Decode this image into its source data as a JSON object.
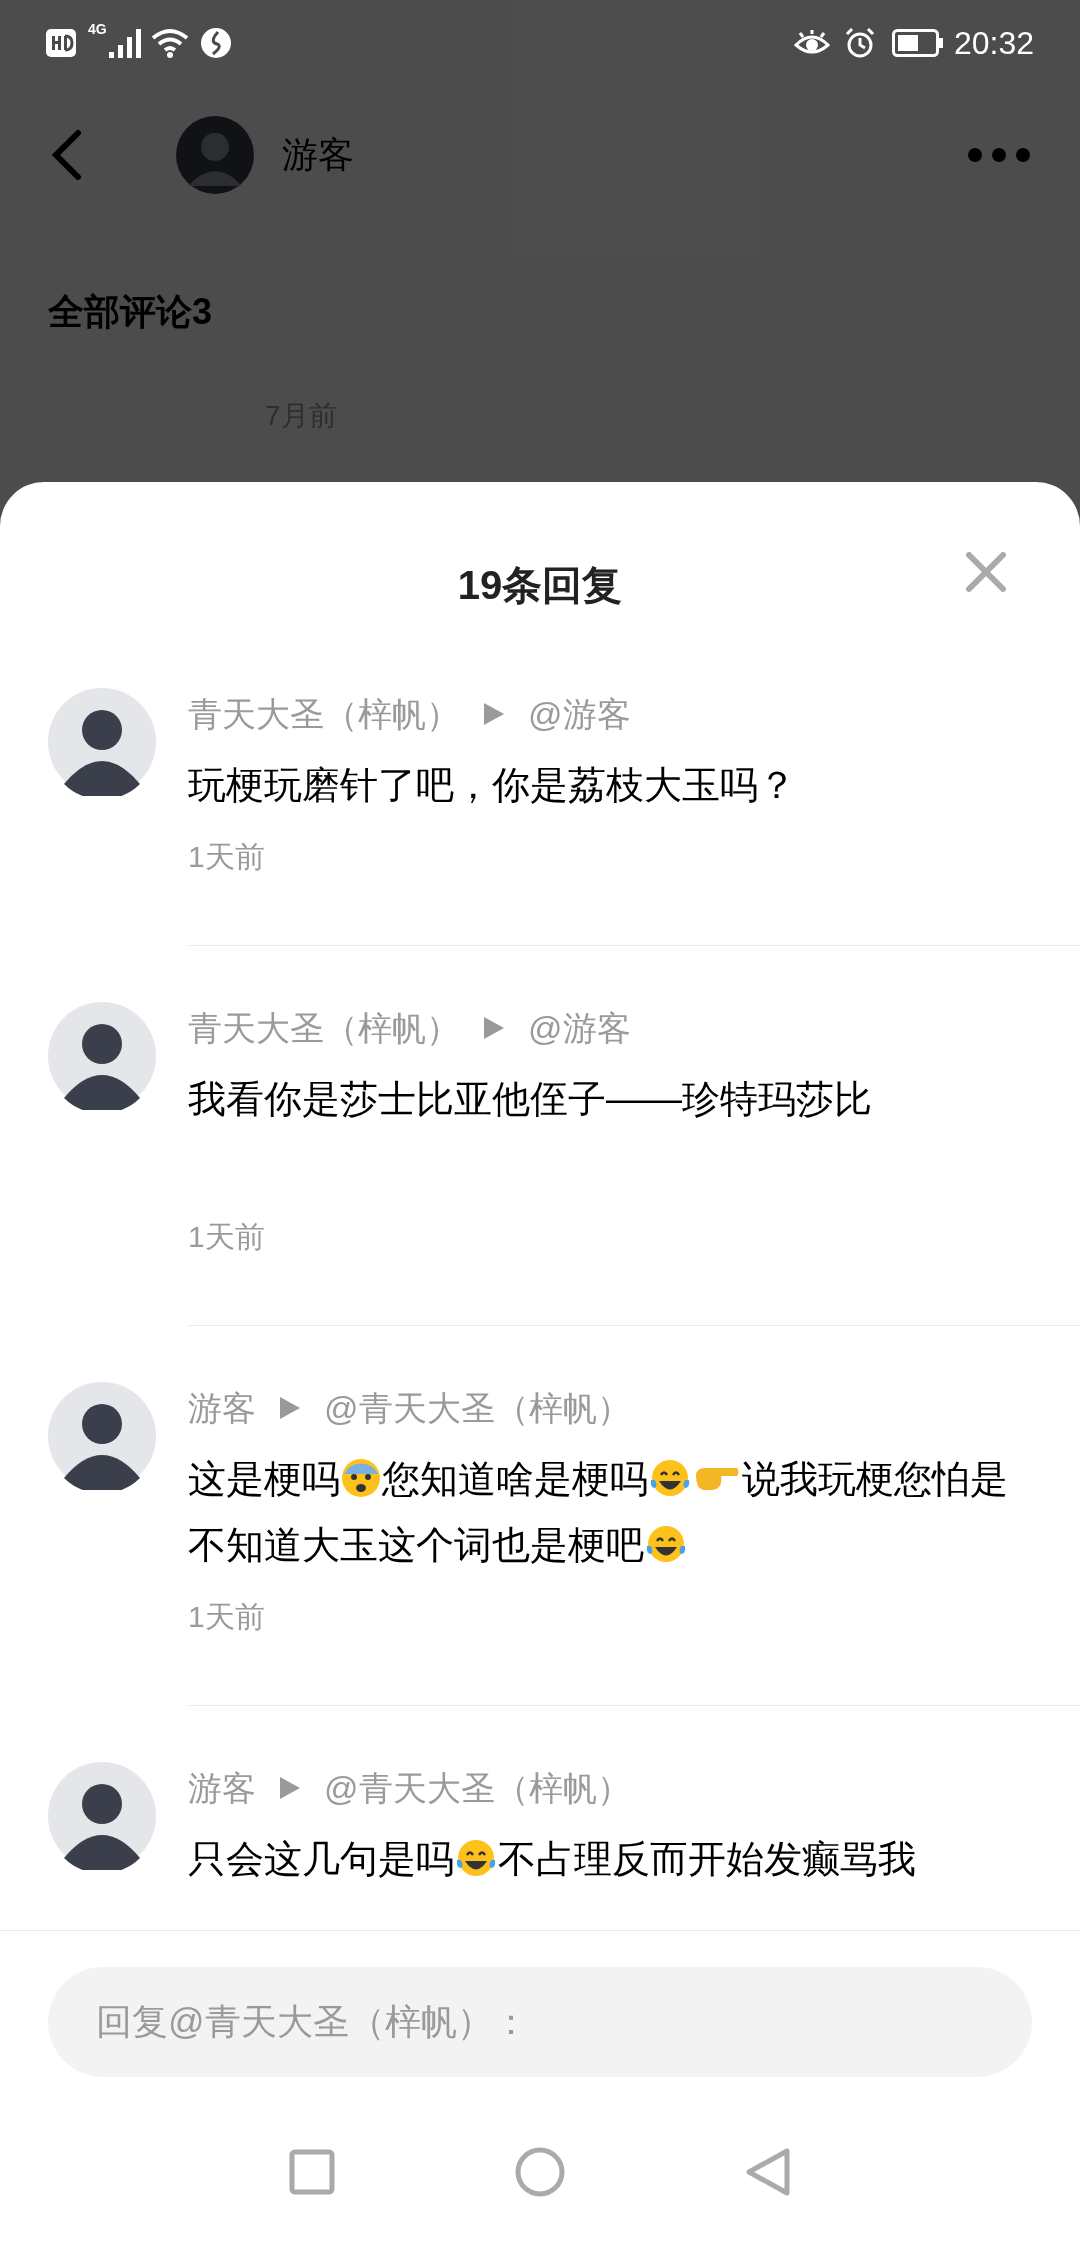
{
  "status_bar": {
    "time": "20:32",
    "network": "4G"
  },
  "header": {
    "username": "游客"
  },
  "page": {
    "section_title": "全部评论3",
    "comment_time": "7月前"
  },
  "sheet": {
    "title": "19条回复",
    "replies": [
      {
        "author": "青天大圣（梓帆）",
        "target": "@游客",
        "segments": [
          {
            "kind": "text",
            "text": "玩梗玩磨针了吧，你是荔枝大玉吗？"
          }
        ],
        "time": "1天前"
      },
      {
        "author": "青天大圣（梓帆）",
        "target": "@游客",
        "segments": [
          {
            "kind": "text",
            "text": "我看你是莎士比亚他侄子——珍特玛莎比\n\n"
          }
        ],
        "time": "1天前"
      },
      {
        "author": "游客",
        "target": "@青天大圣（梓帆）",
        "segments": [
          {
            "kind": "text",
            "text": "这是梗吗"
          },
          {
            "kind": "fear"
          },
          {
            "kind": "text",
            "text": "您知道啥是梗吗"
          },
          {
            "kind": "laugh"
          },
          {
            "kind": "point"
          },
          {
            "kind": "text",
            "text": "说我玩梗您怕是不知道大玉这个词也是梗吧"
          },
          {
            "kind": "laugh"
          }
        ],
        "time": "1天前"
      },
      {
        "author": "游客",
        "target": "@青天大圣（梓帆）",
        "segments": [
          {
            "kind": "text",
            "text": "只会这几句是吗"
          },
          {
            "kind": "laugh"
          },
          {
            "kind": "text",
            "text": "不占理反而开始发癫骂我"
          }
        ]
      }
    ]
  },
  "reply_box": {
    "placeholder": "回复@青天大圣（梓帆）："
  }
}
